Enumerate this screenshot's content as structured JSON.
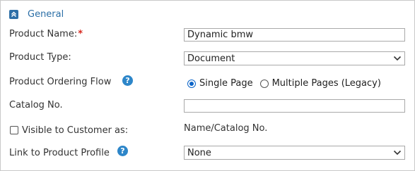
{
  "section": {
    "title": "General",
    "collapse_icon": "chevron-up-icon"
  },
  "fields": {
    "product_name": {
      "label": "Product Name:",
      "required_mark": "*",
      "value": "Dynamic bmw"
    },
    "product_type": {
      "label": "Product Type:",
      "selected": "Document"
    },
    "ordering_flow": {
      "label": "Product Ordering Flow",
      "help": "?",
      "options": [
        {
          "label": "Single Page",
          "checked": true
        },
        {
          "label": "Multiple Pages (Legacy)",
          "checked": false
        }
      ]
    },
    "catalog_no": {
      "label": "Catalog No.",
      "value": ""
    },
    "visible_to_customer": {
      "label": "Visible to Customer as:",
      "checked": false,
      "value": "Name/Catalog No."
    },
    "product_profile": {
      "label": "Link to Product Profile",
      "help": "?",
      "selected": "None"
    }
  },
  "colors": {
    "accent": "#2a6ea6",
    "help_icon": "#2d86c9",
    "required": "#d7281e",
    "radio_selected": "#0a64c8"
  }
}
